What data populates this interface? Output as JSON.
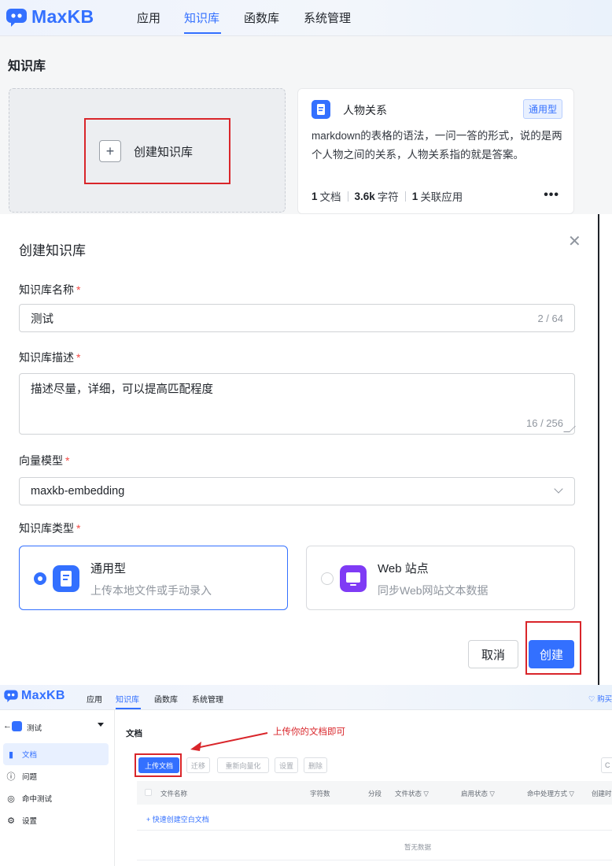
{
  "brand": {
    "logo_text": "MaxKB",
    "accent": "#3370ff",
    "annotation_red": "#d9252a"
  },
  "section1": {
    "nav": [
      {
        "label": "应用"
      },
      {
        "label": "知识库",
        "active": true
      },
      {
        "label": "函数库"
      },
      {
        "label": "系统管理"
      }
    ],
    "page_title": "知识库",
    "create_card": {
      "plus_glyph": "+",
      "label": "创建知识库"
    },
    "kb_card": {
      "name": "人物关系",
      "tag": "通用型",
      "description": "markdown的表格的语法，一问一答的形式，说的是两个人物之间的关系，人物关系指的就是答案。",
      "stats": [
        {
          "value": "1",
          "unit": "文档"
        },
        {
          "value": "3.6k",
          "unit": "字符"
        },
        {
          "value": "1",
          "unit": "关联应用"
        }
      ],
      "more_glyph": "•••"
    }
  },
  "dialog": {
    "title": "创建知识库",
    "close_glyph": "✕",
    "name_field": {
      "label": "知识库名称",
      "required": "*",
      "value": "测试",
      "counter": "2 / 64"
    },
    "desc_field": {
      "label": "知识库描述",
      "required": "*",
      "placeholder": "描述尽量，详细，可以提高匹配程度",
      "counter": "16 / 256"
    },
    "model_field": {
      "label": "向量模型",
      "required": "*",
      "value": "maxkb-embedding"
    },
    "type_field": {
      "label": "知识库类型",
      "required": "*",
      "options": [
        {
          "name": "通用型",
          "desc": "上传本地文件或手动录入",
          "selected": true,
          "icon_color": "#3370ff"
        },
        {
          "name": "Web 站点",
          "desc": "同步Web网站文本数据",
          "selected": false,
          "icon_color": "#7f3bf5"
        }
      ]
    },
    "buttons": {
      "cancel": "取消",
      "create": "创建"
    }
  },
  "section3": {
    "nav": [
      {
        "label": "应用"
      },
      {
        "label": "知识库",
        "active": true
      },
      {
        "label": "函数库"
      },
      {
        "label": "系统管理"
      }
    ],
    "buy_label": "购买专业",
    "sidebar": {
      "back_glyph": "←",
      "kb_name": "测试",
      "items": [
        {
          "label": "文档",
          "icon": "document-icon",
          "active": true
        },
        {
          "label": "问题",
          "icon": "question-icon"
        },
        {
          "label": "命中测试",
          "icon": "target-icon"
        },
        {
          "label": "设置",
          "icon": "gear-icon"
        }
      ]
    },
    "main_title": "文档",
    "annotation": "上传你的文档即可",
    "toolbar": [
      {
        "label": "上传文档",
        "primary": true
      },
      {
        "label": "迁移"
      },
      {
        "label": "重新向量化"
      },
      {
        "label": "设置"
      },
      {
        "label": "删除"
      }
    ],
    "toolbar_right": "C",
    "table_headers": [
      "文件名称",
      "字符数",
      "分段",
      "文件状态",
      "启用状态",
      "命中处理方式",
      "创建时"
    ],
    "quick_create": "+ 快速创建空白文档",
    "empty_text": "暂无数据"
  }
}
